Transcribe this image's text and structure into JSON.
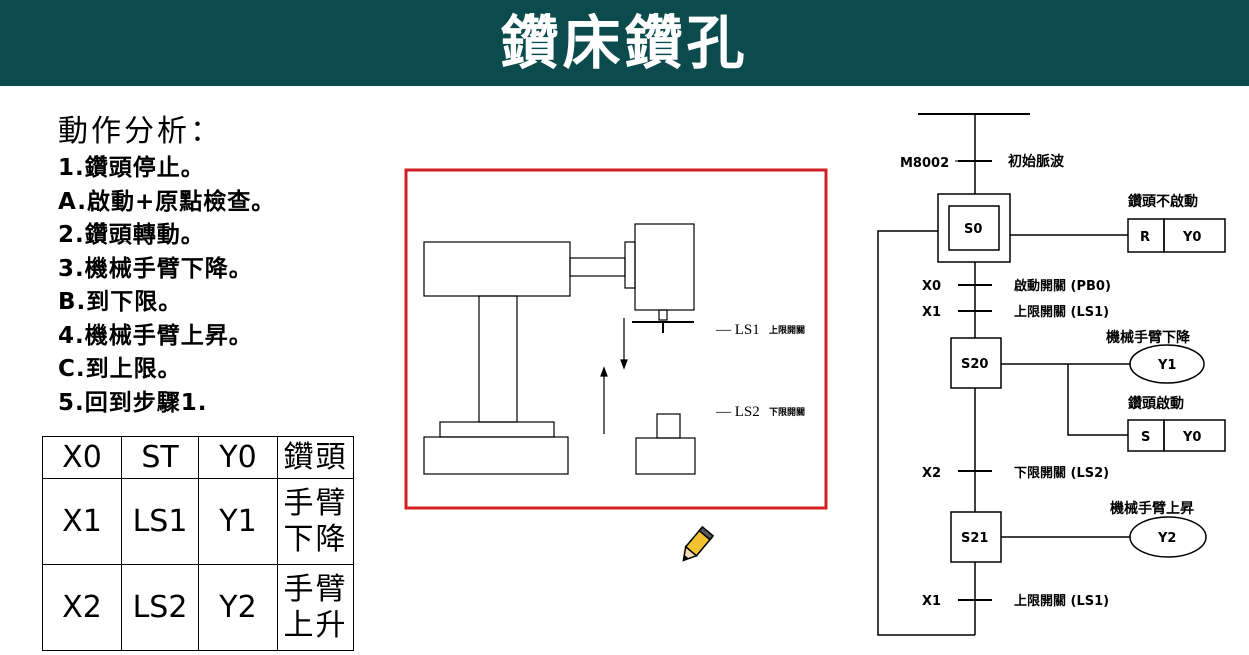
{
  "header": {
    "title": "鑽床鑽孔"
  },
  "analysis": {
    "heading": "動作分析：",
    "steps": [
      "1.鑽頭停止。",
      "A.啟動+原點檢查。",
      "2.鑽頭轉動。",
      "3.機械手臂下降。",
      "B.到下限。",
      "4.機械手臂上昇。",
      "C.到上限。",
      "5.回到步驟1."
    ]
  },
  "io_table": {
    "rows": [
      {
        "input": "X0",
        "device": "ST",
        "output": "Y0",
        "desc": [
          "鑽頭"
        ]
      },
      {
        "input": "X1",
        "device": "LS1",
        "output": "Y1",
        "desc": [
          "手臂",
          "下降"
        ]
      },
      {
        "input": "X2",
        "device": "LS2",
        "output": "Y2",
        "desc": [
          "手臂",
          "上升"
        ]
      }
    ]
  },
  "machine_diagram": {
    "border_color": "#d01f1f",
    "ls1_label": "— LS1",
    "ls1_desc": "上限開關",
    "ls2_label": "— LS2",
    "ls2_desc": "下限開關"
  },
  "sfc": {
    "init_contact": "M8002",
    "init_desc": "初始脈波",
    "s0": "S0",
    "s20": "S20",
    "s21": "S21",
    "t1_contact": "X0",
    "t1_desc": "啟動開關 (PB0)",
    "t1b_contact": "X1",
    "t1b_desc": "上限開關 (LS1)",
    "t2_contact": "X2",
    "t2_desc": "下限開關 (LS2)",
    "t3_contact": "X1",
    "t3_desc": "上限開關 (LS1)",
    "s0_action_label": "鑽頭不啟動",
    "s0_action_cmd": "R",
    "s0_action_out": "Y0",
    "s20_action1_label": "機械手臂下降",
    "s20_action1_out": "Y1",
    "s20_action2_label": "鑽頭啟動",
    "s20_action2_cmd": "S",
    "s20_action2_out": "Y0",
    "s21_action_label": "機械手臂上昇",
    "s21_action_out": "Y2"
  },
  "cursor": {
    "icon": "pencil-cursor-icon"
  }
}
